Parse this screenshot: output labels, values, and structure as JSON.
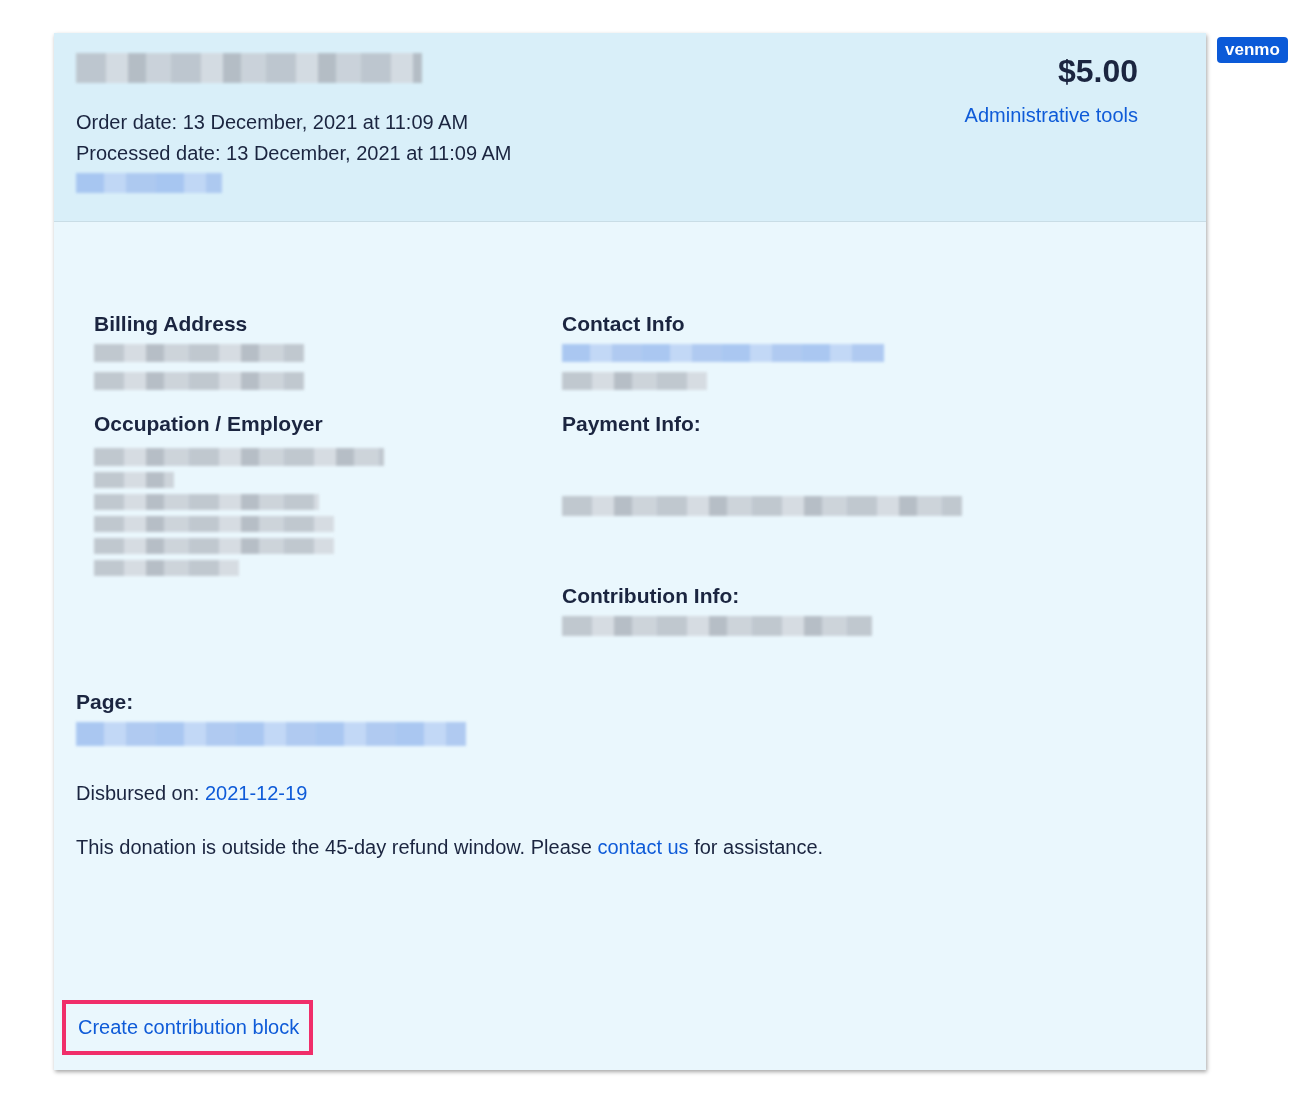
{
  "badge": "venmo",
  "header": {
    "amount": "$5.00",
    "order_date": "Order date: 13 December, 2021 at 11:09 AM",
    "processed_date": "Processed date: 13 December, 2021 at 11:09 AM",
    "admin_link": "Administrative tools"
  },
  "left_sections": [
    {
      "heading": "Billing Address"
    },
    {
      "heading": "Occupation / Employer"
    }
  ],
  "right_sections": [
    {
      "heading": "Contact Info"
    },
    {
      "heading": "Payment Info:"
    },
    {
      "heading": "Contribution Info:"
    }
  ],
  "page_label": "Page:",
  "disbursed": {
    "label": "Disbursed on:",
    "date": "2021-12-19"
  },
  "notice": {
    "before": "This donation is outside the 45-day refund window. Please",
    "link": "contact us",
    "after": "for assistance."
  },
  "create_link": {
    "label": "Create contribution block",
    "highlighted": true
  }
}
